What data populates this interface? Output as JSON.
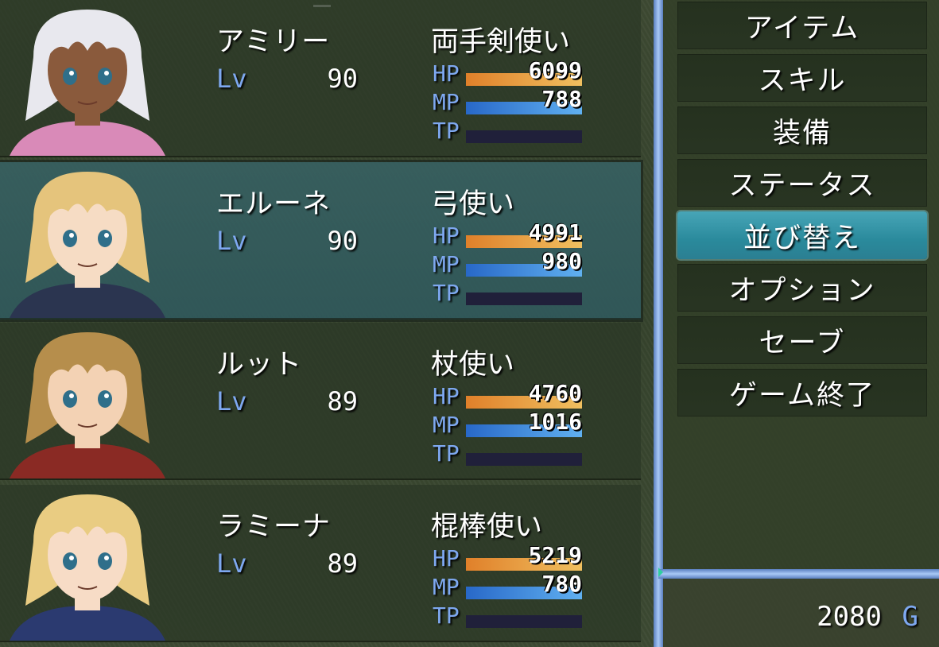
{
  "party": [
    {
      "name": "アミリー",
      "level_label": "Lv",
      "level": "90",
      "class": "両手剣使い",
      "hp_label": "HP",
      "hp": "6099",
      "hp_fill": 1.0,
      "mp_label": "MP",
      "mp": "788",
      "mp_fill": 1.0,
      "tp_label": "TP",
      "tp_fill": 0.0,
      "hair_color": "#e8e8ee",
      "skin_color": "#8a5a3c",
      "outfit_color": "#d98ab8"
    },
    {
      "name": "エルーネ",
      "level_label": "Lv",
      "level": "90",
      "class": "弓使い",
      "hp_label": "HP",
      "hp": "4991",
      "hp_fill": 1.0,
      "mp_label": "MP",
      "mp": "980",
      "mp_fill": 1.0,
      "tp_label": "TP",
      "tp_fill": 0.0,
      "hair_color": "#e5c47c",
      "skin_color": "#f6dcc4",
      "outfit_color": "#2b3550"
    },
    {
      "name": "ルット",
      "level_label": "Lv",
      "level": "89",
      "class": "杖使い",
      "hp_label": "HP",
      "hp": "4760",
      "hp_fill": 1.0,
      "mp_label": "MP",
      "mp": "1016",
      "mp_fill": 1.0,
      "tp_label": "TP",
      "tp_fill": 0.0,
      "hair_color": "#b68e4c",
      "skin_color": "#f3d2b4",
      "outfit_color": "#8a2a24"
    },
    {
      "name": "ラミーナ",
      "level_label": "Lv",
      "level": "89",
      "class": "棍棒使い",
      "hp_label": "HP",
      "hp": "5219",
      "hp_fill": 1.0,
      "mp_label": "MP",
      "mp": "780",
      "mp_fill": 1.0,
      "tp_label": "TP",
      "tp_fill": 0.0,
      "hair_color": "#e9cc82",
      "skin_color": "#f7dcc6",
      "outfit_color": "#2b3a70"
    }
  ],
  "menu": {
    "items": [
      "アイテム",
      "スキル",
      "装備",
      "ステータス",
      "並び替え",
      "オプション",
      "セーブ",
      "ゲーム終了"
    ],
    "selected_index": 4
  },
  "gold": {
    "value": "2080",
    "unit": "G"
  },
  "colors": {
    "system_blue": "#7ea8f0",
    "hp_gauge": "#f0a040",
    "mp_gauge": "#40a0e8",
    "tp_gauge_bg": "#20203a",
    "selected_highlight": "#2a8a9c"
  }
}
